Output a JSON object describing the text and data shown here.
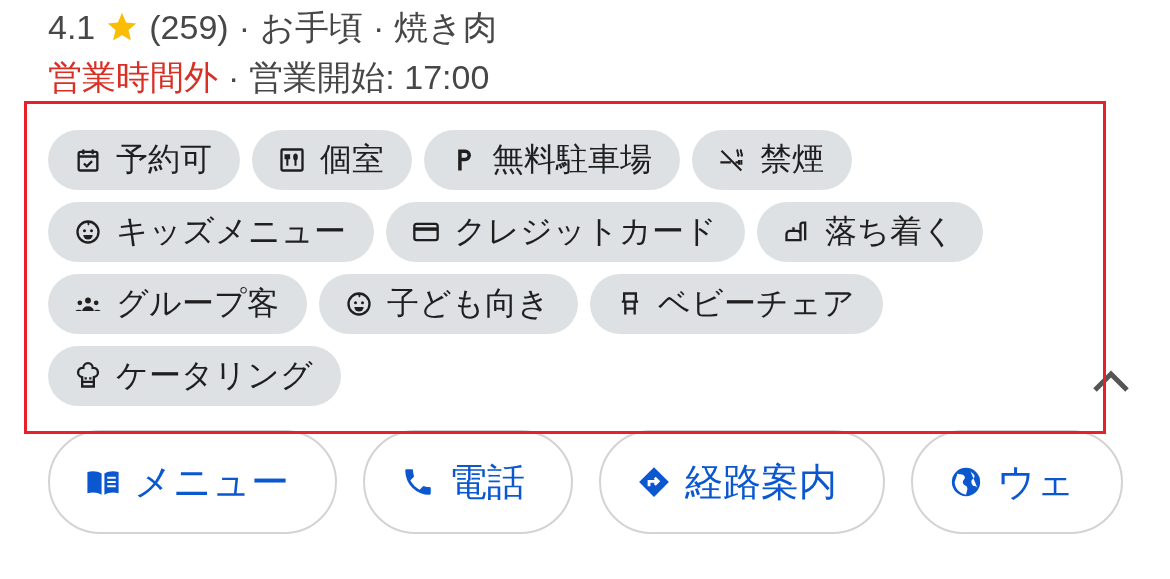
{
  "summary": {
    "rating": "4.1",
    "review_count": "(259)",
    "separator_1": "·",
    "price": "お手頃",
    "separator_2": "·",
    "category": "焼き肉"
  },
  "hours": {
    "status": "営業時間外",
    "separator": "·",
    "opening": "営業開始: 17:00"
  },
  "attributes": [
    {
      "kind": "calendar",
      "label": "予約可"
    },
    {
      "kind": "dining",
      "label": "個室"
    },
    {
      "kind": "parking",
      "label": "無料駐車場"
    },
    {
      "kind": "nosmoking",
      "label": "禁煙"
    },
    {
      "kind": "baby",
      "label": "キッズメニュー"
    },
    {
      "kind": "card",
      "label": "クレジットカード"
    },
    {
      "kind": "couch",
      "label": "落ち着く"
    },
    {
      "kind": "group",
      "label": "グループ客"
    },
    {
      "kind": "baby",
      "label": "子ども向き"
    },
    {
      "kind": "chair",
      "label": "ベビーチェア"
    },
    {
      "kind": "chef",
      "label": "ケータリング"
    }
  ],
  "actions": [
    {
      "kind": "menu",
      "label": "メニュー"
    },
    {
      "kind": "phone",
      "label": "電話"
    },
    {
      "kind": "directions",
      "label": "経路案内"
    },
    {
      "kind": "web",
      "label": "ウェ"
    }
  ]
}
